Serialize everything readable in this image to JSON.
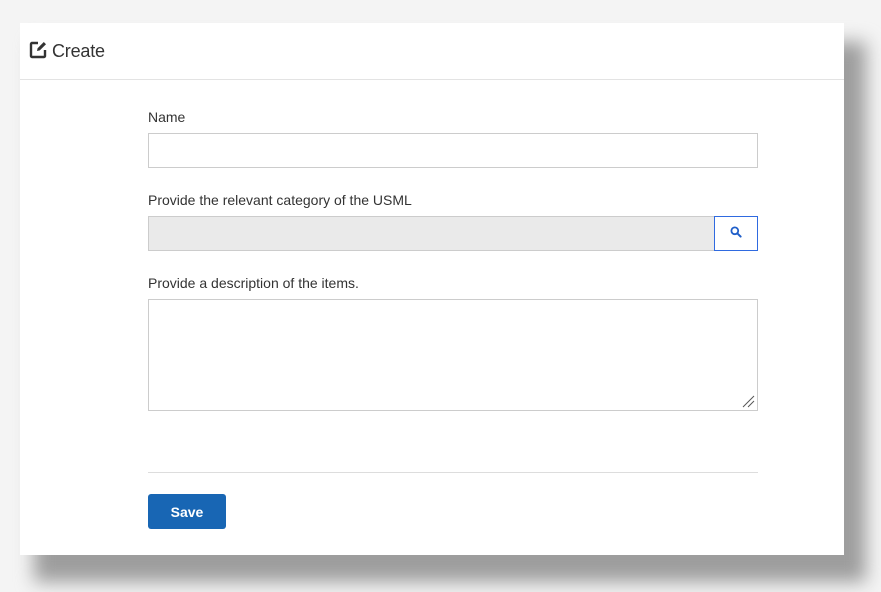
{
  "header": {
    "title": "Create",
    "icon": "edit-icon"
  },
  "form": {
    "name_label": "Name",
    "name_value": "",
    "category_label": "Provide the relevant category of the USML",
    "category_value": "",
    "category_lookup_icon": "search-icon",
    "description_label": "Provide a description of the items.",
    "description_value": ""
  },
  "actions": {
    "save_label": "Save"
  },
  "colors": {
    "primary_button": "#1866b4",
    "lookup_border": "#2f6ae0",
    "readonly_field": "#eaeaea"
  }
}
